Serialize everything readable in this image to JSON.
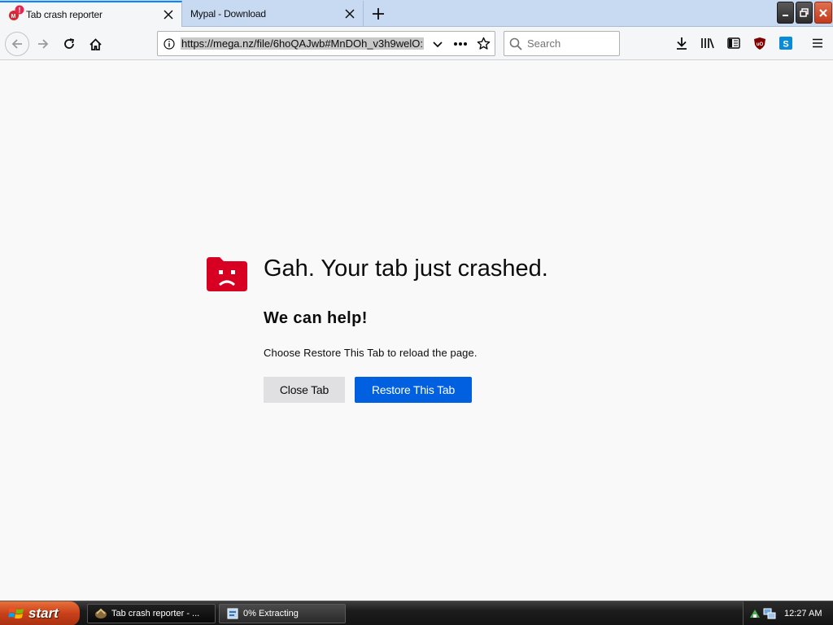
{
  "tabs": [
    {
      "title": "Tab crash reporter",
      "active": true
    },
    {
      "title": "Mypal - Download",
      "active": false
    }
  ],
  "tab_badge": "!",
  "nav": {
    "url": "https://mega.nz/file/6hoQAJwb#MnDOh_v3h9welO:",
    "search_placeholder": "Search",
    "ublock_label": "uO",
    "skype_label": "S"
  },
  "crash": {
    "title": "Gah. Your tab just crashed.",
    "subtitle": "We can help!",
    "description": "Choose Restore This Tab to reload the page.",
    "close_button": "Close Tab",
    "restore_button": "Restore This Tab"
  },
  "taskbar": {
    "start_label": "start",
    "tasks": [
      {
        "label": "Tab crash reporter - ..."
      },
      {
        "label": "0% Extracting"
      }
    ],
    "clock": "12:27 AM"
  },
  "colors": {
    "accent": "#0060df",
    "crash_icon": "#d70022"
  }
}
